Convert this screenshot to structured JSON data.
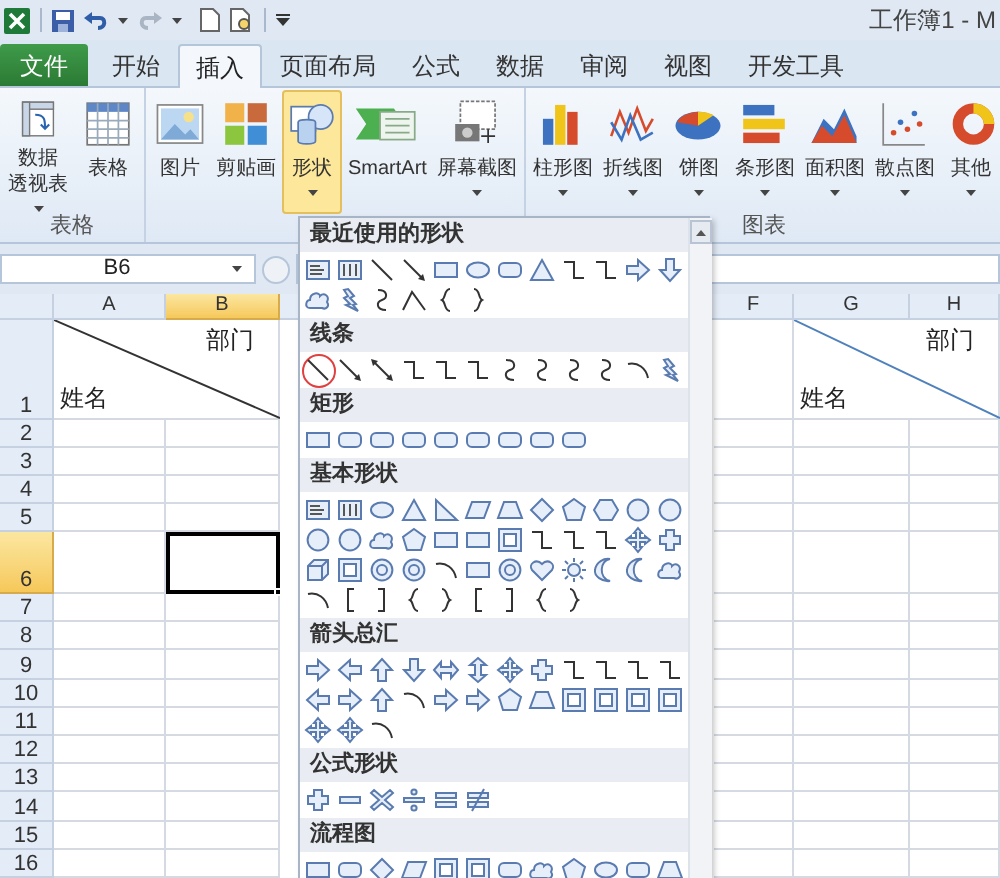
{
  "title_bar": {
    "title": "工作簿1 - M"
  },
  "tabs": [
    {
      "label": "文件",
      "kind": "file"
    },
    {
      "label": "开始",
      "kind": "tab",
      "selected": false
    },
    {
      "label": "插入",
      "kind": "tab",
      "selected": true
    },
    {
      "label": "页面布局",
      "kind": "tab",
      "selected": false
    },
    {
      "label": "公式",
      "kind": "tab",
      "selected": false
    },
    {
      "label": "数据",
      "kind": "tab",
      "selected": false
    },
    {
      "label": "审阅",
      "kind": "tab",
      "selected": false
    },
    {
      "label": "视图",
      "kind": "tab",
      "selected": false
    },
    {
      "label": "开发工具",
      "kind": "tab",
      "selected": false
    }
  ],
  "ribbon": {
    "groups": [
      {
        "label": "表格",
        "buttons": [
          {
            "kind": "pivot",
            "lines": [
              "数据",
              "透视表"
            ],
            "dropdown": true,
            "pressed": false
          },
          {
            "kind": "table",
            "lines": [
              "表格"
            ],
            "dropdown": false,
            "pressed": false
          }
        ]
      },
      {
        "buttons": [
          {
            "kind": "picture",
            "lines": [
              "图片"
            ],
            "dropdown": false,
            "pressed": false
          },
          {
            "kind": "clipart",
            "lines": [
              "剪贴画"
            ],
            "dropdown": false,
            "pressed": false
          },
          {
            "kind": "shapes",
            "lines": [
              "形状"
            ],
            "dropdown": true,
            "pressed": true
          },
          {
            "kind": "smartart",
            "lines": [
              "SmartArt"
            ],
            "dropdown": false,
            "pressed": false
          },
          {
            "kind": "screenshot",
            "lines": [
              "屏幕截图"
            ],
            "dropdown": true,
            "pressed": false
          }
        ]
      },
      {
        "label": "图表",
        "buttons": [
          {
            "kind": "column",
            "lines": [
              "柱形图"
            ],
            "dropdown": true,
            "pressed": false
          },
          {
            "kind": "line",
            "lines": [
              "折线图"
            ],
            "dropdown": true,
            "pressed": false
          },
          {
            "kind": "pie",
            "lines": [
              "饼图"
            ],
            "dropdown": true,
            "pressed": false
          },
          {
            "kind": "bar",
            "lines": [
              "条形图"
            ],
            "dropdown": true,
            "pressed": false
          },
          {
            "kind": "area",
            "lines": [
              "面积图"
            ],
            "dropdown": true,
            "pressed": false
          },
          {
            "kind": "scatter",
            "lines": [
              "散点图"
            ],
            "dropdown": true,
            "pressed": false
          },
          {
            "kind": "other",
            "lines": [
              "其他"
            ],
            "dropdown": true,
            "pressed": false
          }
        ]
      }
    ]
  },
  "name_box": {
    "value": "B6"
  },
  "sheet": {
    "columns": [
      {
        "label": "A",
        "selected": false
      },
      {
        "label": "B",
        "selected": true
      },
      {
        "label": "F",
        "selected": false
      },
      {
        "label": "G",
        "selected": false
      },
      {
        "label": "H",
        "selected": false
      }
    ],
    "rows": [
      {
        "label": "1",
        "selected": false
      },
      {
        "label": "2",
        "selected": false
      },
      {
        "label": "3",
        "selected": false
      },
      {
        "label": "4",
        "selected": false
      },
      {
        "label": "5",
        "selected": false
      },
      {
        "label": "6",
        "selected": true
      },
      {
        "label": "7",
        "selected": false
      },
      {
        "label": "8",
        "selected": false
      },
      {
        "label": "9",
        "selected": false
      },
      {
        "label": "10",
        "selected": false
      },
      {
        "label": "11",
        "selected": false
      },
      {
        "label": "12",
        "selected": false
      },
      {
        "label": "13",
        "selected": false
      },
      {
        "label": "14",
        "selected": false
      },
      {
        "label": "15",
        "selected": false
      },
      {
        "label": "16",
        "selected": false
      }
    ],
    "diagonal_headers": [
      {
        "kind": "cell-border",
        "top": "部门",
        "bottom": "姓名"
      },
      {
        "kind": "shape-line",
        "top": "部门",
        "bottom": "姓名"
      }
    ]
  },
  "shapes_menu": {
    "sections": [
      {
        "title": "最近使用的形状",
        "circled_first": false
      },
      {
        "title": "线条",
        "circled_first": true
      },
      {
        "title": "矩形",
        "circled_first": false
      },
      {
        "title": "基本形状",
        "circled_first": false
      },
      {
        "title": "箭头总汇",
        "circled_first": false
      },
      {
        "title": "公式形状",
        "circled_first": false
      },
      {
        "title": "流程图",
        "circled_first": false
      }
    ]
  }
}
